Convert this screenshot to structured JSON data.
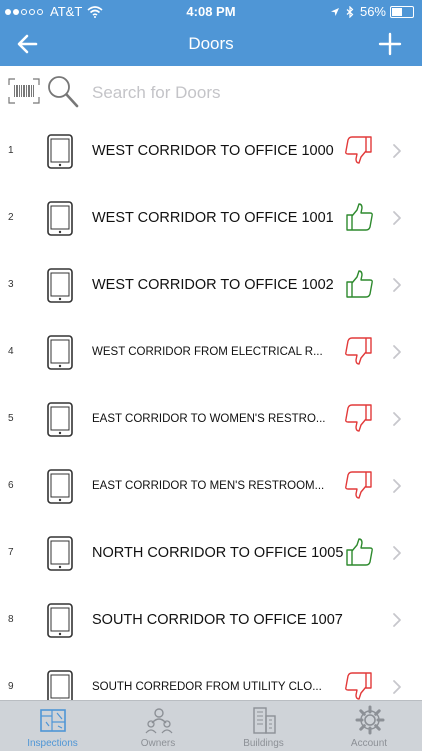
{
  "status_bar": {
    "carrier": "AT&T",
    "time": "4:08 PM",
    "battery": "56%",
    "battery_level": 0.56
  },
  "nav": {
    "title": "Doors",
    "back_icon": "arrow-left-icon",
    "add_icon": "plus-icon"
  },
  "search": {
    "placeholder": "Search for Doors",
    "barcode_icon": "barcode-scan-icon",
    "search_icon": "magnifier-icon"
  },
  "colors": {
    "header": "#4f96d6",
    "pass": "#2e8a2e",
    "fail": "#e23a3a"
  },
  "doors": [
    {
      "number": "1",
      "name": "WEST CORRIDOR TO OFFICE 1000",
      "status": "fail"
    },
    {
      "number": "2",
      "name": "WEST CORRIDOR TO OFFICE 1001",
      "status": "pass"
    },
    {
      "number": "3",
      "name": "WEST CORRIDOR TO OFFICE 1002",
      "status": "pass"
    },
    {
      "number": "4",
      "name": "WEST CORRIDOR FROM ELECTRICAL R...",
      "status": "fail"
    },
    {
      "number": "5",
      "name": "EAST CORRIDOR TO WOMEN'S RESTRO...",
      "status": "fail"
    },
    {
      "number": "6",
      "name": "EAST CORRIDOR TO MEN'S RESTROOM...",
      "status": "fail"
    },
    {
      "number": "7",
      "name": "NORTH CORRIDOR TO OFFICE 1005",
      "status": "pass"
    },
    {
      "number": "8",
      "name": "SOUTH CORRIDOR TO OFFICE 1007",
      "status": "none"
    },
    {
      "number": "9",
      "name": "SOUTH CORREDOR FROM UTILITY CLO...",
      "status": "fail"
    }
  ],
  "tabs": [
    {
      "label": "Inspections",
      "icon": "blueprint-icon",
      "active": true
    },
    {
      "label": "Owners",
      "icon": "people-icon",
      "active": false
    },
    {
      "label": "Buildings",
      "icon": "building-icon",
      "active": false
    },
    {
      "label": "Account",
      "icon": "gear-icon",
      "active": false
    }
  ]
}
